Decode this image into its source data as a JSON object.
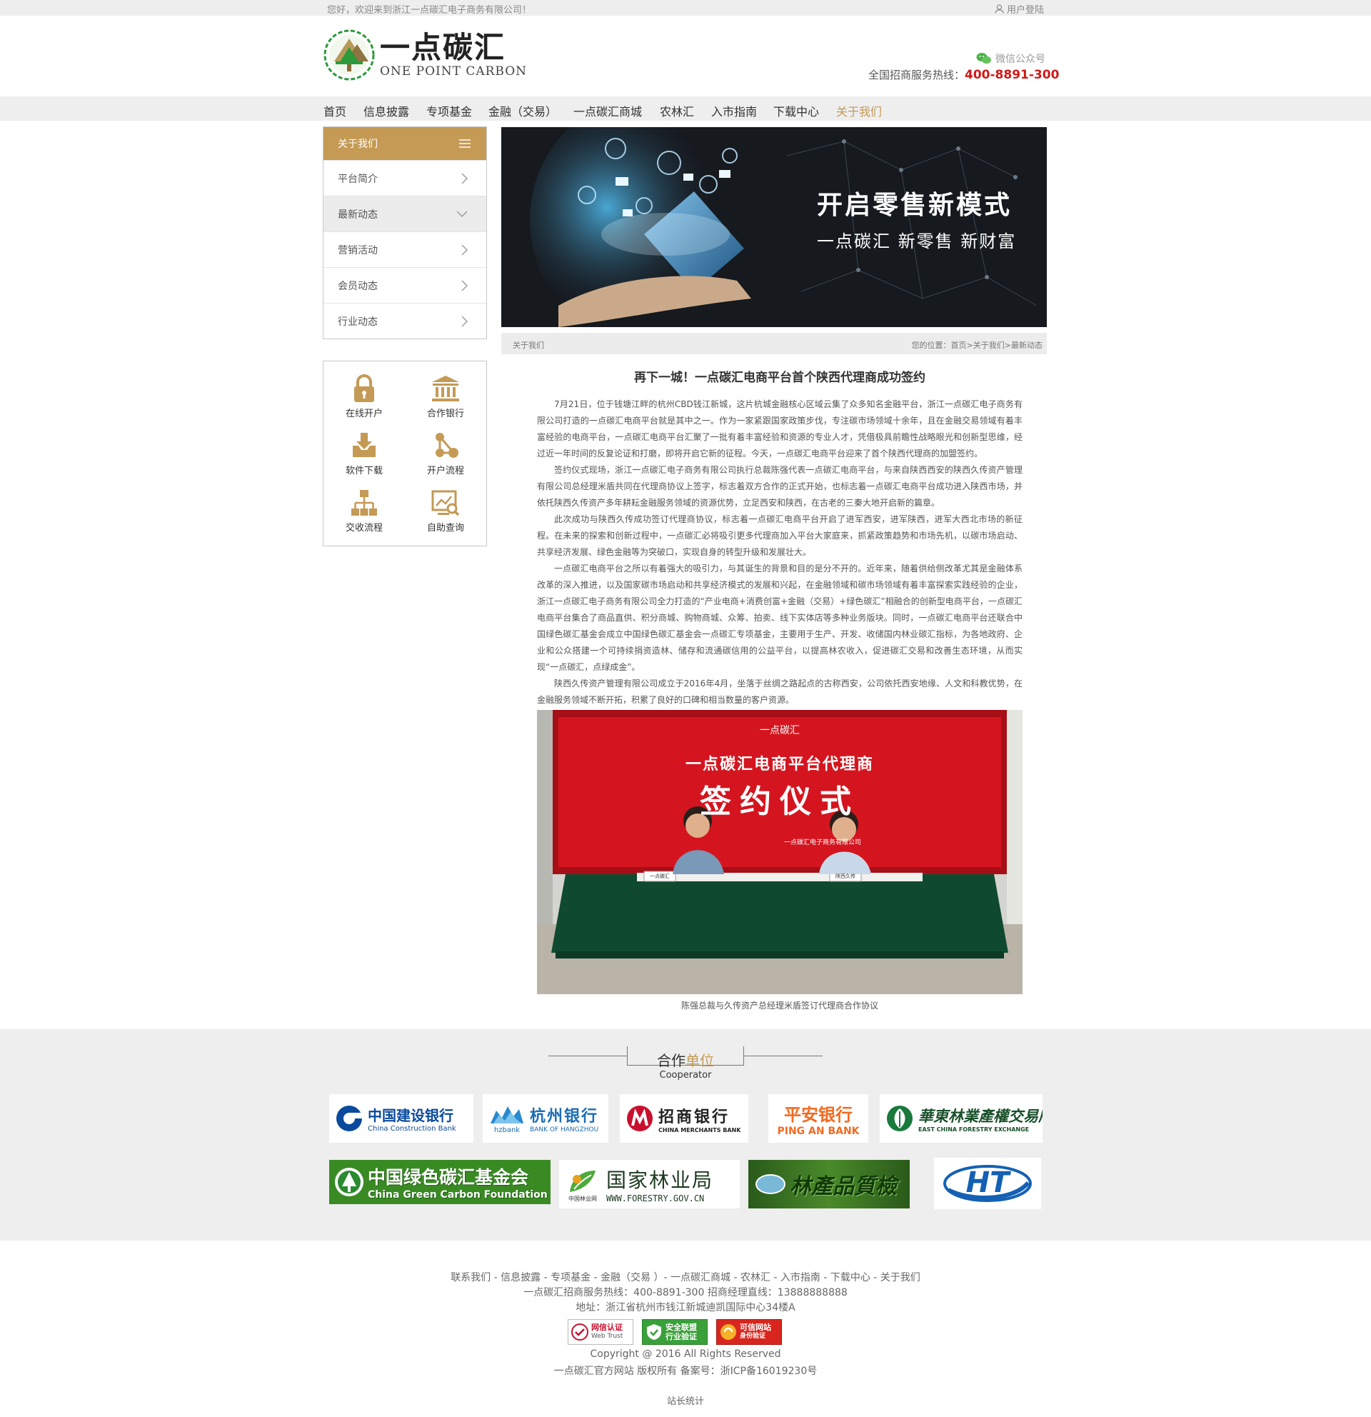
{
  "topbar": {
    "welcome": "您好，欢迎来到浙江一点碳汇电子商务有限公司！",
    "login": "用户登陆"
  },
  "brand": {
    "name_cn": "一点碳汇",
    "name_en": "ONE POINT CARBON"
  },
  "contact": {
    "wechat": "微信公众号",
    "hotline_label": "全国招商服务热线：",
    "hotline": "400-8891-300"
  },
  "nav": [
    {
      "label": "首页"
    },
    {
      "label": "信息披露"
    },
    {
      "label": "专项基金"
    },
    {
      "label": "金融（交易）"
    },
    {
      "label": "一点碳汇商城"
    },
    {
      "label": "农林汇"
    },
    {
      "label": "入市指南"
    },
    {
      "label": "下载中心"
    },
    {
      "label": "关于我们",
      "active": true
    }
  ],
  "sidebar": {
    "title": "关于我们",
    "items": [
      {
        "label": "平台简介"
      },
      {
        "label": "最新动态",
        "active": true
      },
      {
        "label": "营销活动"
      },
      {
        "label": "会员动态"
      },
      {
        "label": "行业动态"
      }
    ]
  },
  "quick_links": [
    {
      "label": "在线开户",
      "icon": "lock-icon"
    },
    {
      "label": "合作银行",
      "icon": "bank-icon"
    },
    {
      "label": "软件下载",
      "icon": "download-icon"
    },
    {
      "label": "开户流程",
      "icon": "process-icon"
    },
    {
      "label": "交收流程",
      "icon": "hierarchy-icon"
    },
    {
      "label": "自助查询",
      "icon": "chart-search-icon"
    }
  ],
  "banner": {
    "headline": "开启零售新模式",
    "subline": "一点碳汇 新零售 新财富"
  },
  "breadcrumb": {
    "section": "关于我们",
    "path": "您的位置：首页>关于我们>最新动态"
  },
  "article": {
    "title": "再下一城！一点碳汇电商平台首个陕西代理商成功签约",
    "paragraphs": [
      "7月21日，位于钱塘江畔的杭州CBD钱江新城，这片杭城金融核心区域云集了众多知名金融平台，浙江一点碳汇电子商务有限公司打造的一点碳汇电商平台就是其中之一。作为一家紧跟国家政策步伐，专注碳市场领域十余年，且在金融交易领域有着丰富经验的电商平台，一点碳汇电商平台汇聚了一批有着丰富经验和资源的专业人才，凭借极具前瞻性战略眼光和创新型思维，经过近一年时间的反复论证和打磨，即将开启它新的征程。今天，一点碳汇电商平台迎来了首个陕西代理商的加盟签约。",
      "签约仪式现场，浙江一点碳汇电子商务有限公司执行总裁陈强代表一点碳汇电商平台，与来自陕西西安的陕西久传资产管理有限公司总经理米盾共同在代理商协议上签字，标志着双方合作的正式开始，也标志着一点碳汇电商平台成功进入陕西市场，并依托陕西久传资产多年耕耘金融服务领域的资源优势，立足西安和陕西，在古老的三秦大地开启新的篇章。",
      "此次成功与陕西久传成功签订代理商协议，标志着一点碳汇电商平台开启了进军西安，进军陕西，进军大西北市场的新征程。在未来的探索和创新过程中，一点碳汇必将吸引更多代理商加入平台大家庭来，抓紧政策趋势和市场先机，以碳市场启动、共享经济发展、绿色金融等为突破口，实现自身的转型升级和发展壮大。",
      "一点碳汇电商平台之所以有着强大的吸引力，与其诞生的背景和目的是分不开的。近年来，随着供给侧改革尤其是金融体系改革的深入推进，以及国家碳市场启动和共享经济模式的发展和兴起，在金融领域和碳市场领域有着丰富探索实践经验的企业，浙江一点碳汇电子商务有限公司全力打造的“产业电商+消费创富+金融（交易）+绿色碳汇”相融合的创新型电商平台，一点碳汇电商平台集合了商品直供、积分商城、购物商城、众筹、拍卖、线下实体店等多种业务版块。同时，一点碳汇电商平台还联合中国绿色碳汇基金会成立中国绿色碳汇基金会一点碳汇专项基金，主要用于生产、开发、收储国内林业碳汇指标，为各地政府、企业和公众搭建一个可持续捐资造林、储存和流通碳信用的公益平台，以提高林农收入，促进碳汇交易和改善生态环境，从而实现“一点碳汇，点绿成金”。",
      "陕西久传资产管理有限公司成立于2016年4月，坐落于丝绸之路起点的古称西安，公司依托西安地缘、人文和科教优势，在金融服务领域不断开拓，积累了良好的口碑和相当数量的客户资源。"
    ],
    "photo": {
      "screen_logo": "一点碳汇",
      "screen_line1": "一点碳汇电商平台代理商",
      "screen_line2": "签约仪式",
      "screen_company": "一点碳汇电子商务有限公司",
      "sign_left": "一点碳汇",
      "sign_right": "陕西久传"
    },
    "caption": "陈强总裁与久传资产总经理米盾签订代理商合作协议"
  },
  "partners": {
    "title_a": "合作",
    "title_b": "单位",
    "subtitle": "Cooperator",
    "logos": [
      {
        "cn": "中国建设银行",
        "en": "China Construction Bank",
        "color": "#0a4a9c"
      },
      {
        "cn": "杭州银行",
        "en": "BANK OF HANGZHOU",
        "prefix": "hzbank",
        "color": "#1b6cb4"
      },
      {
        "cn": "招商银行",
        "en": "CHINA MERCHANTS BANK",
        "color": "#c8102e"
      },
      {
        "cn": "平安银行",
        "en": "PING AN BANK",
        "color": "#f26a21"
      },
      {
        "cn": "華東林業產權交易所",
        "en": "EAST CHINA FORESTRY EXCHANGE",
        "color": "#1a7a3c"
      },
      {
        "cn": "中国绿色碳汇基金会",
        "en": "China Green Carbon Foundation",
        "color": "#ffffff"
      },
      {
        "cn": "国家林业局",
        "en": "WWW.FORESTRY.GOV.CN",
        "sub": "中国林业网",
        "color": "#1d5a2c"
      },
      {
        "cn": "林產品質檢",
        "en": "",
        "color": "#1d3a12"
      },
      {
        "cn": "HT",
        "en": "",
        "color": "#1461b4"
      }
    ]
  },
  "footer": {
    "links": "联系我们 - 信息披露 - 专项基金 - 金融（交易 ）- 一点碳汇商城 - 农林汇 - 入市指南 - 下载中心 - 关于我们",
    "phones": "一点碳汇招商服务热线：400-8891-300   招商经理直线：13888888888",
    "address": "地址：浙江省杭州市钱江新城迪凯国际中心34楼A",
    "badges": [
      {
        "l1": "网信认证",
        "l2": "Web Trust"
      },
      {
        "l1": "安全联盟",
        "l2": "行业验证"
      },
      {
        "l1": "可信网站",
        "l2": "身份验证"
      }
    ],
    "copyright": "Copyright @ 2016 All Rights Reserved",
    "icp": "一点碳汇官方网站 版权所有 备案号：浙ICP备16019230号",
    "stats": "站长统计"
  }
}
